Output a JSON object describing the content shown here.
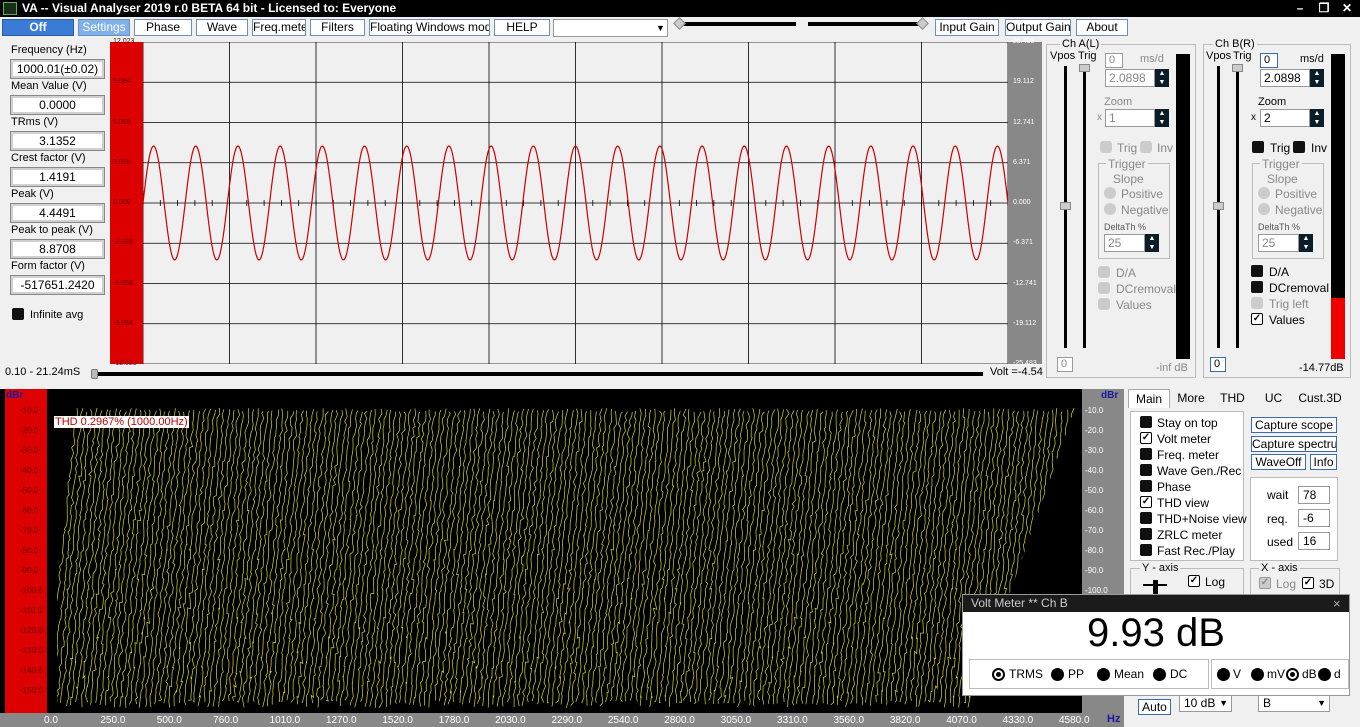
{
  "window": {
    "title": "VA -- Visual Analyser 2019 r.0 BETA 64 bit - Licensed to: Everyone",
    "min": "–",
    "max": "❐",
    "close": "✕"
  },
  "toolbar": {
    "off": "Off",
    "settings": "Settings",
    "phase": "Phase",
    "wave": "Wave",
    "freqmeter": "Freq.meter",
    "filters": "Filters",
    "floating": "Floating Windows mode",
    "help": "HELP",
    "input_gain": "Input Gain",
    "output_gain": "Output Gain",
    "about": "About",
    "combo_value": ""
  },
  "measurements": [
    {
      "label": "Frequency (Hz)",
      "value": "1000.01(±0.02)"
    },
    {
      "label": "Mean Value (V)",
      "value": "0.0000"
    },
    {
      "label": "TRms (V)",
      "value": "3.1352"
    },
    {
      "label": "Crest factor (V)",
      "value": "1.4191"
    },
    {
      "label": "Peak (V)",
      "value": "4.4491"
    },
    {
      "label": "Peak to peak (V)",
      "value": "8.8708"
    },
    {
      "label": "Form factor (V)",
      "value": "-517651.2420"
    }
  ],
  "infinite_avg": "Infinite avg",
  "scope": {
    "left_ticks": [
      "12.023",
      "9.084",
      "6.056",
      "3.028",
      "0.000",
      "-3.028",
      "-6.056",
      "-9.084",
      "-12.023"
    ],
    "right_ticks": [
      "25.483",
      "19.112",
      "12.741",
      "6.371",
      "0.000",
      "-6.371",
      "-12.741",
      "-19.112",
      "-25.483"
    ],
    "time_range": "0.10 - 21.24mS",
    "volt": "Volt =-4.54",
    "trace_color": "#cc0000",
    "cycles": 20.5
  },
  "chA": {
    "title": "Ch A(L)",
    "vpos": "Vpos",
    "trig": "Trig",
    "zero": "0",
    "msd": "ms/d",
    "msd_value": "2.0898",
    "zoom": "Zoom",
    "x": "x",
    "zoom_value": "1",
    "trig_chk": "Trig",
    "inv_chk": "Inv",
    "trigger": "Trigger",
    "slope": "Slope",
    "positive": "Positive",
    "negative": "Negative",
    "delta": "DeltaTh %",
    "delta_value": "25",
    "da": "D/A",
    "dcremoval": "DCremoval",
    "values": "Values",
    "bottom_zero": "0",
    "db": "-inf dB",
    "meter_level": 0
  },
  "chB": {
    "title": "Ch B(R)",
    "vpos": "Vpos",
    "trig": "Trig",
    "zero": "0",
    "msd": "ms/d",
    "msd_value": "2.0898",
    "zoom": "Zoom",
    "x": "x",
    "zoom_value": "2",
    "trig_chk": "Trig",
    "inv_chk": "Inv",
    "trigger": "Trigger",
    "slope": "Slope",
    "positive": "Positive",
    "negative": "Negative",
    "delta": "DeltaTh %",
    "delta_value": "25",
    "da": "D/A",
    "dcremoval": "DCremoval",
    "trigleft": "Trig left",
    "values": "Values",
    "bottom_zero": "0",
    "db": "-14.77dB",
    "meter_level": 0.2
  },
  "spectrum": {
    "thd": "THD 0.2967% (1000.00Hz)",
    "unit_left": "dBr",
    "unit_right": "dBr",
    "hz": "Hz",
    "y_ticks": [
      "-10.0",
      "-20.0",
      "-30.0",
      "-40.0",
      "-50.0",
      "-60.0",
      "-70.0",
      "-80.0",
      "-90.0",
      "-100.0",
      "-110.0",
      "-120.0",
      "-130.0",
      "-140.0",
      "-150.0"
    ],
    "x_ticks": [
      "0.0",
      "250.0",
      "500.0",
      "760.0",
      "1010.0",
      "1270.0",
      "1520.0",
      "1780.0",
      "2030.0",
      "2290.0",
      "2540.0",
      "2800.0",
      "3050.0",
      "3310.0",
      "3560.0",
      "3820.0",
      "4070.0",
      "4330.0",
      "4580.0"
    ],
    "trace_color": "#ffff33"
  },
  "tabs": [
    "Main",
    "More",
    "THD",
    "UC",
    "Cust.3D"
  ],
  "options": [
    {
      "label": "Stay on top",
      "checked": false
    },
    {
      "label": "Volt meter",
      "checked": true
    },
    {
      "label": "Freq. meter",
      "checked": false
    },
    {
      "label": "Wave Gen./Rec",
      "checked": false
    },
    {
      "label": "Phase",
      "checked": false
    },
    {
      "label": "THD view",
      "checked": true
    },
    {
      "label": "THD+Noise view",
      "checked": false
    },
    {
      "label": "ZRLC meter",
      "checked": false
    },
    {
      "label": "Fast Rec./Play",
      "checked": false
    }
  ],
  "actions": {
    "capture_scope": "Capture scope",
    "capture_spectrum": "Capture spectrum",
    "waveoff": "WaveOff",
    "info": "Info"
  },
  "fields": {
    "wait": "wait",
    "wait_v": "78",
    "req": "req.",
    "req_v": "-6",
    "used": "used",
    "used_v": "16"
  },
  "yaxis": {
    "title": "Y - axis",
    "log": "Log",
    "auto": "Auto",
    "scale": "10 dB"
  },
  "xaxis": {
    "title": "X - axis",
    "log": "Log",
    "threed": "3D",
    "window": "B"
  },
  "voltmeter": {
    "title": "Volt Meter ** Ch B",
    "close": "×",
    "reading": "9.93 dB",
    "modes": [
      "TRMS",
      "PP",
      "Mean",
      "DC"
    ],
    "selected_mode": "TRMS",
    "units": [
      "V",
      "mV",
      "dB",
      "d"
    ],
    "selected_unit": "dB"
  }
}
